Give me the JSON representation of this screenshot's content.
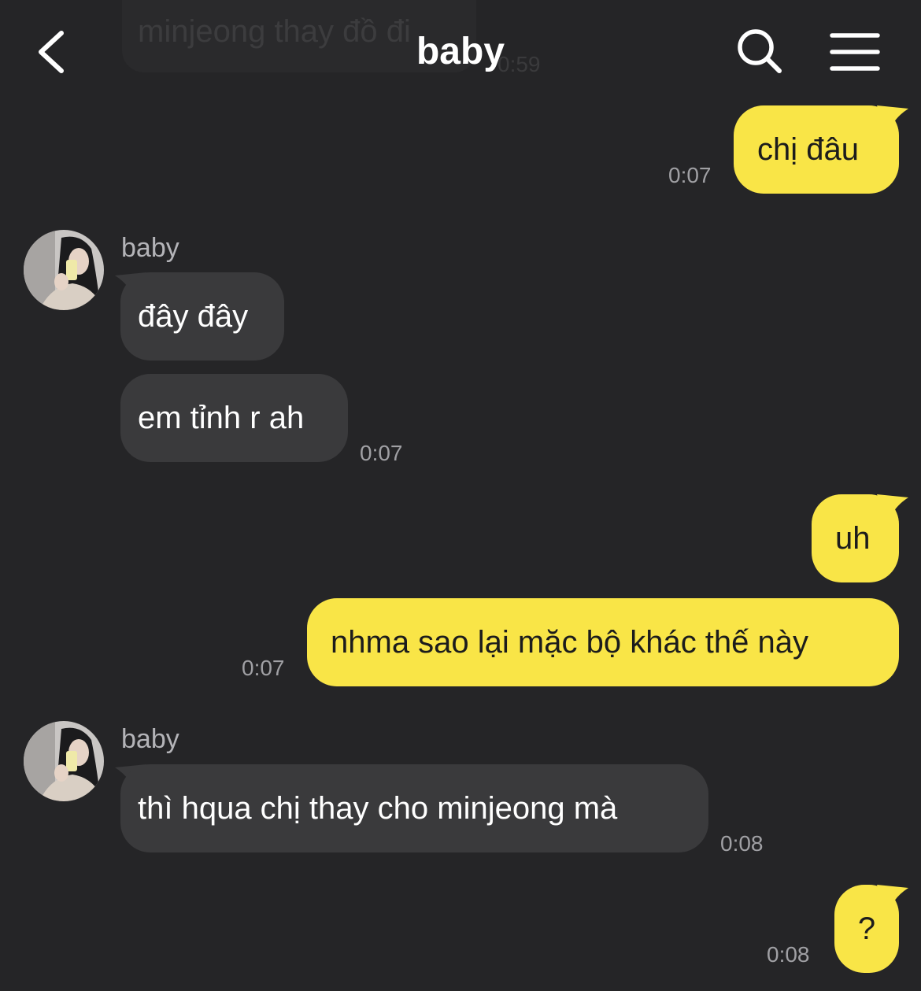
{
  "header": {
    "title": "baby",
    "back_icon": "chevron-left-icon",
    "search_icon": "search-icon",
    "menu_icon": "hamburger-menu-icon"
  },
  "ghost": {
    "text": "minjeong thay đồ đi",
    "time": "0:59"
  },
  "colors": {
    "background": "#252527",
    "outgoing": "#f9e547",
    "incoming": "#3a3a3c"
  },
  "messages": [
    {
      "dir": "out",
      "text": "chị đâu",
      "time": "0:07"
    },
    {
      "dir": "in",
      "sender": "baby",
      "text": "đây đây"
    },
    {
      "dir": "in",
      "text": "em tỉnh r ah",
      "time": "0:07"
    },
    {
      "dir": "out",
      "text": "uh"
    },
    {
      "dir": "out",
      "text": "nhma sao lại mặc bộ khác thế này",
      "time": "0:07"
    },
    {
      "dir": "in",
      "sender": "baby",
      "text": "thì hqua chị thay cho minjeong mà",
      "time": "0:08"
    },
    {
      "dir": "out",
      "text": "?",
      "time": "0:08"
    }
  ]
}
